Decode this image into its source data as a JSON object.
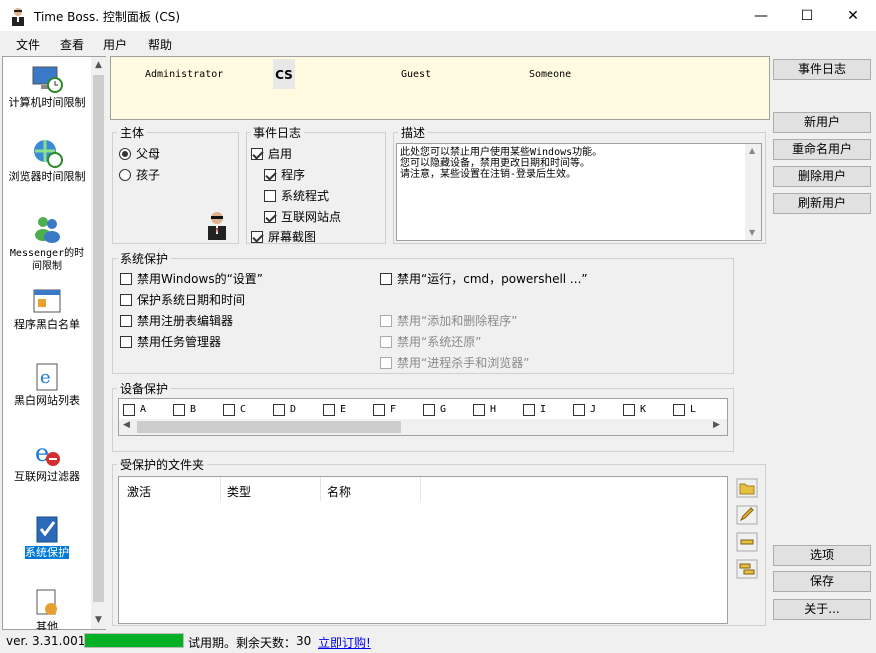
{
  "window": {
    "title": "Time Boss. 控制面板 (CS)",
    "minimize": "—",
    "maximize": "☐",
    "close": "✕"
  },
  "menu": [
    "文件",
    "查看",
    "用户",
    "帮助"
  ],
  "nav": [
    {
      "label": "计算机时间限制"
    },
    {
      "label": "浏览器时间限制"
    },
    {
      "label": "Messenger的时间限制"
    },
    {
      "label": "程序黑白名单"
    },
    {
      "label": "黑白网站列表"
    },
    {
      "label": "互联网过滤器"
    },
    {
      "label": "系统保护"
    },
    {
      "label": "其他"
    }
  ],
  "users": [
    "Administrator",
    "CS",
    "Guest",
    "Someone"
  ],
  "subject": {
    "title": "主体",
    "options": [
      {
        "label": "父母",
        "checked": true
      },
      {
        "label": "孩子",
        "checked": false
      }
    ]
  },
  "eventlog": {
    "title": "事件日志",
    "items": [
      {
        "label": "启用",
        "checked": true
      },
      {
        "label": "程序",
        "checked": true
      },
      {
        "label": "系统程式",
        "checked": false
      },
      {
        "label": "互联网站点",
        "checked": true
      },
      {
        "label": "屏幕截图",
        "checked": true
      }
    ]
  },
  "description": {
    "title": "描述",
    "text": "此处您可以禁止用户使用某些Windows功能。\n您可以隐藏设备，禁用更改日期和时间等。\n请注意，某些设置在注销-登录后生效。"
  },
  "sysprotect": {
    "title": "系统保护",
    "left": [
      "禁用Windows的“设置”",
      "保护系统日期和时间",
      "禁用注册表编辑器",
      "禁用任务管理器"
    ],
    "right": [
      "禁用“运行，cmd，powershell ...”",
      "禁用“添加和删除程序”",
      "禁用“系统还原”",
      "禁用“进程杀手和浏览器”"
    ]
  },
  "devices": {
    "title": "设备保护",
    "drives": [
      "A",
      "B",
      "C",
      "D",
      "E",
      "F",
      "G",
      "H",
      "I",
      "J",
      "K",
      "L"
    ]
  },
  "folders": {
    "title": "受保护的文件夹",
    "columns": [
      "激活",
      "类型",
      "名称"
    ]
  },
  "rightbuttons": {
    "eventlog": "事件日志",
    "newuser": "新用户",
    "rename": "重命名用户",
    "delete": "删除用户",
    "refresh": "刷新用户",
    "options": "选项",
    "save": "保存",
    "about": "关于..."
  },
  "status": {
    "version": "ver. 3.31.001",
    "trial": "试用期。剩余天数：",
    "days": "30",
    "buy": "立即订购!",
    "progress": 1.0
  },
  "colors": {
    "accent": "#0078d7",
    "progress": "#06b025",
    "userbar": "#fffae0"
  }
}
